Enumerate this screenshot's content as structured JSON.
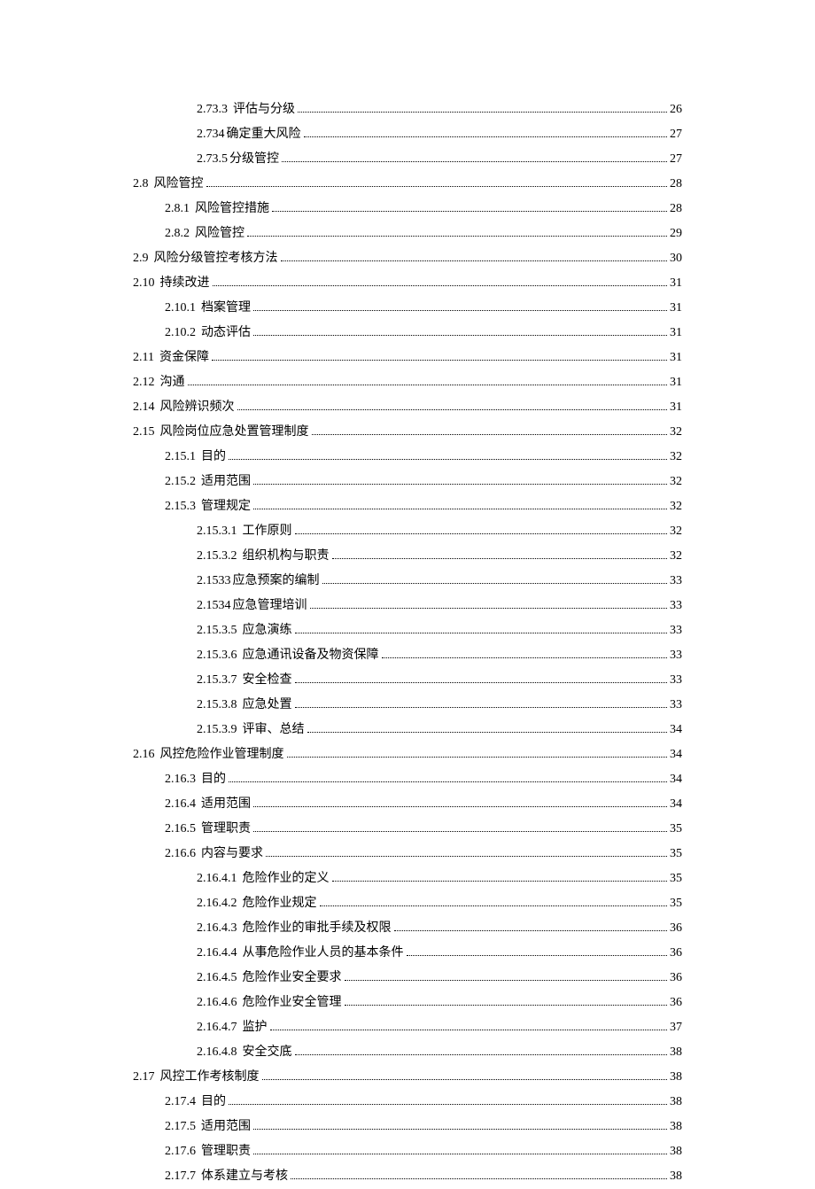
{
  "toc": [
    {
      "indent": 2,
      "num": "2.73.3",
      "title": "评估与分级",
      "page": "26"
    },
    {
      "indent": 2,
      "num": "2.734",
      "title": "确定重大风险",
      "page": "27",
      "tight": true
    },
    {
      "indent": 2,
      "num": "2.73.5",
      "title": "分级管控",
      "page": "27",
      "tight": true
    },
    {
      "indent": 0,
      "num": "2.8",
      "title": "风险管控",
      "page": "28"
    },
    {
      "indent": 1,
      "num": "2.8.1",
      "title": "风险管控措施",
      "page": "28"
    },
    {
      "indent": 1,
      "num": "2.8.2",
      "title": "风险管控",
      "page": "29"
    },
    {
      "indent": 0,
      "num": "2.9",
      "title": "风险分级管控考核方法",
      "page": "30"
    },
    {
      "indent": 0,
      "num": "2.10",
      "title": "持续改进",
      "page": "31"
    },
    {
      "indent": 1,
      "num": "2.10.1",
      "title": "档案管理",
      "page": "31"
    },
    {
      "indent": 1,
      "num": "2.10.2",
      "title": "动态评估",
      "page": "31"
    },
    {
      "indent": 0,
      "num": "2.11",
      "title": "资金保障",
      "page": "31"
    },
    {
      "indent": 0,
      "num": "2.12",
      "title": "沟通",
      "page": "31"
    },
    {
      "indent": 0,
      "num": "2.14",
      "title": "风险辨识频次",
      "page": "31"
    },
    {
      "indent": 0,
      "num": "2.15",
      "title": "风险岗位应急处置管理制度",
      "page": "32"
    },
    {
      "indent": 1,
      "num": "2.15.1",
      "title": "目的",
      "page": "32"
    },
    {
      "indent": 1,
      "num": "2.15.2",
      "title": "适用范围",
      "page": "32"
    },
    {
      "indent": 1,
      "num": "2.15.3",
      "title": "管理规定",
      "page": "32"
    },
    {
      "indent": 2,
      "num": "2.15.3.1",
      "title": "工作原则",
      "page": "32"
    },
    {
      "indent": 2,
      "num": "2.15.3.2",
      "title": "组织机构与职责",
      "page": "32"
    },
    {
      "indent": 2,
      "num": "2.1533",
      "title": "应急预案的编制",
      "page": "33",
      "tight": true
    },
    {
      "indent": 2,
      "num": "2.1534",
      "title": "应急管理培训",
      "page": "33",
      "tight": true
    },
    {
      "indent": 2,
      "num": "2.15.3.5",
      "title": "应急演练",
      "page": "33"
    },
    {
      "indent": 2,
      "num": "2.15.3.6",
      "title": "应急通讯设备及物资保障",
      "page": "33"
    },
    {
      "indent": 2,
      "num": "2.15.3.7",
      "title": "安全检查",
      "page": "33"
    },
    {
      "indent": 2,
      "num": "2.15.3.8",
      "title": "应急处置",
      "page": "33"
    },
    {
      "indent": 2,
      "num": "2.15.3.9",
      "title": "评审、总结",
      "page": "34"
    },
    {
      "indent": 0,
      "num": "2.16",
      "title": "风控危险作业管理制度",
      "page": "34"
    },
    {
      "indent": 1,
      "num": "2.16.3",
      "title": "目的",
      "page": "34"
    },
    {
      "indent": 1,
      "num": "2.16.4",
      "title": "适用范围",
      "page": "34"
    },
    {
      "indent": 1,
      "num": "2.16.5",
      "title": "管理职责",
      "page": "35"
    },
    {
      "indent": 1,
      "num": "2.16.6",
      "title": "内容与要求",
      "page": "35"
    },
    {
      "indent": 2,
      "num": "2.16.4.1",
      "title": "危险作业的定义",
      "page": "35"
    },
    {
      "indent": 2,
      "num": "2.16.4.2",
      "title": "危险作业规定",
      "page": "35"
    },
    {
      "indent": 2,
      "num": "2.16.4.3",
      "title": "危险作业的审批手续及权限",
      "page": "36"
    },
    {
      "indent": 2,
      "num": "2.16.4.4",
      "title": "从事危险作业人员的基本条件",
      "page": "36"
    },
    {
      "indent": 2,
      "num": "2.16.4.5",
      "title": "危险作业安全要求",
      "page": "36"
    },
    {
      "indent": 2,
      "num": "2.16.4.6",
      "title": "危险作业安全管理",
      "page": "36"
    },
    {
      "indent": 2,
      "num": "2.16.4.7",
      "title": "监护",
      "page": "37"
    },
    {
      "indent": 2,
      "num": "2.16.4.8",
      "title": "安全交底",
      "page": "38"
    },
    {
      "indent": 0,
      "num": "2.17",
      "title": "风控工作考核制度",
      "page": "38"
    },
    {
      "indent": 1,
      "num": "2.17.4",
      "title": "目的",
      "page": "38"
    },
    {
      "indent": 1,
      "num": "2.17.5",
      "title": "适用范围",
      "page": "38"
    },
    {
      "indent": 1,
      "num": "2.17.6",
      "title": "管理职责",
      "page": "38"
    },
    {
      "indent": 1,
      "num": "2.17.7",
      "title": "体系建立与考核",
      "page": "38"
    }
  ]
}
